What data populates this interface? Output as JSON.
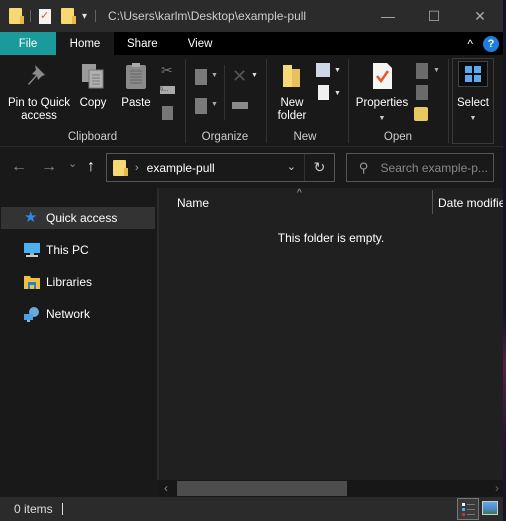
{
  "window": {
    "title_path": "C:\\Users\\karlm\\Desktop\\example-pull",
    "controls": {
      "minimize": "—",
      "maximize": "☐",
      "close": "✕"
    }
  },
  "quick_access_toolbar": {
    "icons": [
      "folder-icon",
      "properties-icon",
      "new-folder-icon",
      "customize-dropdown-icon"
    ],
    "dropdown_glyph": "▾"
  },
  "tabs": [
    {
      "label": "File",
      "state": "file"
    },
    {
      "label": "Home",
      "state": "active"
    },
    {
      "label": "Share",
      "state": "normal"
    },
    {
      "label": "View",
      "state": "normal"
    }
  ],
  "ribbon": {
    "collapse_glyph": "^",
    "help_glyph": "?",
    "groups": {
      "clipboard": {
        "label": "Clipboard",
        "pin_label_1": "Pin to Quick",
        "pin_label_2": "access",
        "copy_label": "Copy",
        "paste_label": "Paste"
      },
      "organize": {
        "label": "Organize"
      },
      "new": {
        "label": "New",
        "new_folder_1": "New",
        "new_folder_2": "folder"
      },
      "open": {
        "label": "Open",
        "properties_label": "Properties"
      },
      "select": {
        "label": "Select"
      }
    }
  },
  "navigation": {
    "back_glyph": "←",
    "forward_glyph": "→",
    "recent_glyph": "⌄",
    "up_glyph": "↑",
    "breadcrumb_sep": "›",
    "current_folder": "example-pull",
    "address_dropdown_glyph": "⌄",
    "refresh_glyph": "↻",
    "search_placeholder": "Search example-p...",
    "search_glyph": "⚲"
  },
  "nav_pane": {
    "items": [
      {
        "label": "Quick access",
        "icon": "quick-access-star-icon",
        "selected": true
      },
      {
        "label": "This PC",
        "icon": "this-pc-icon",
        "selected": false
      },
      {
        "label": "Libraries",
        "icon": "libraries-icon",
        "selected": false
      },
      {
        "label": "Network",
        "icon": "network-icon",
        "selected": false
      }
    ]
  },
  "content": {
    "columns": [
      "Name",
      "Date modified"
    ],
    "sort_glyph": "^",
    "empty_message": "This folder is empty."
  },
  "scrollbar": {
    "left_glyph": "‹",
    "right_glyph": "›"
  },
  "status_bar": {
    "item_count": "0 items",
    "views": [
      "details-view",
      "large-icons-view"
    ],
    "active_view": "details-view"
  },
  "colors": {
    "file_tab": "#1a9a9a",
    "help": "#1f7de0",
    "folder": "#f8d775",
    "accent_blue": "#4aa8f0"
  }
}
